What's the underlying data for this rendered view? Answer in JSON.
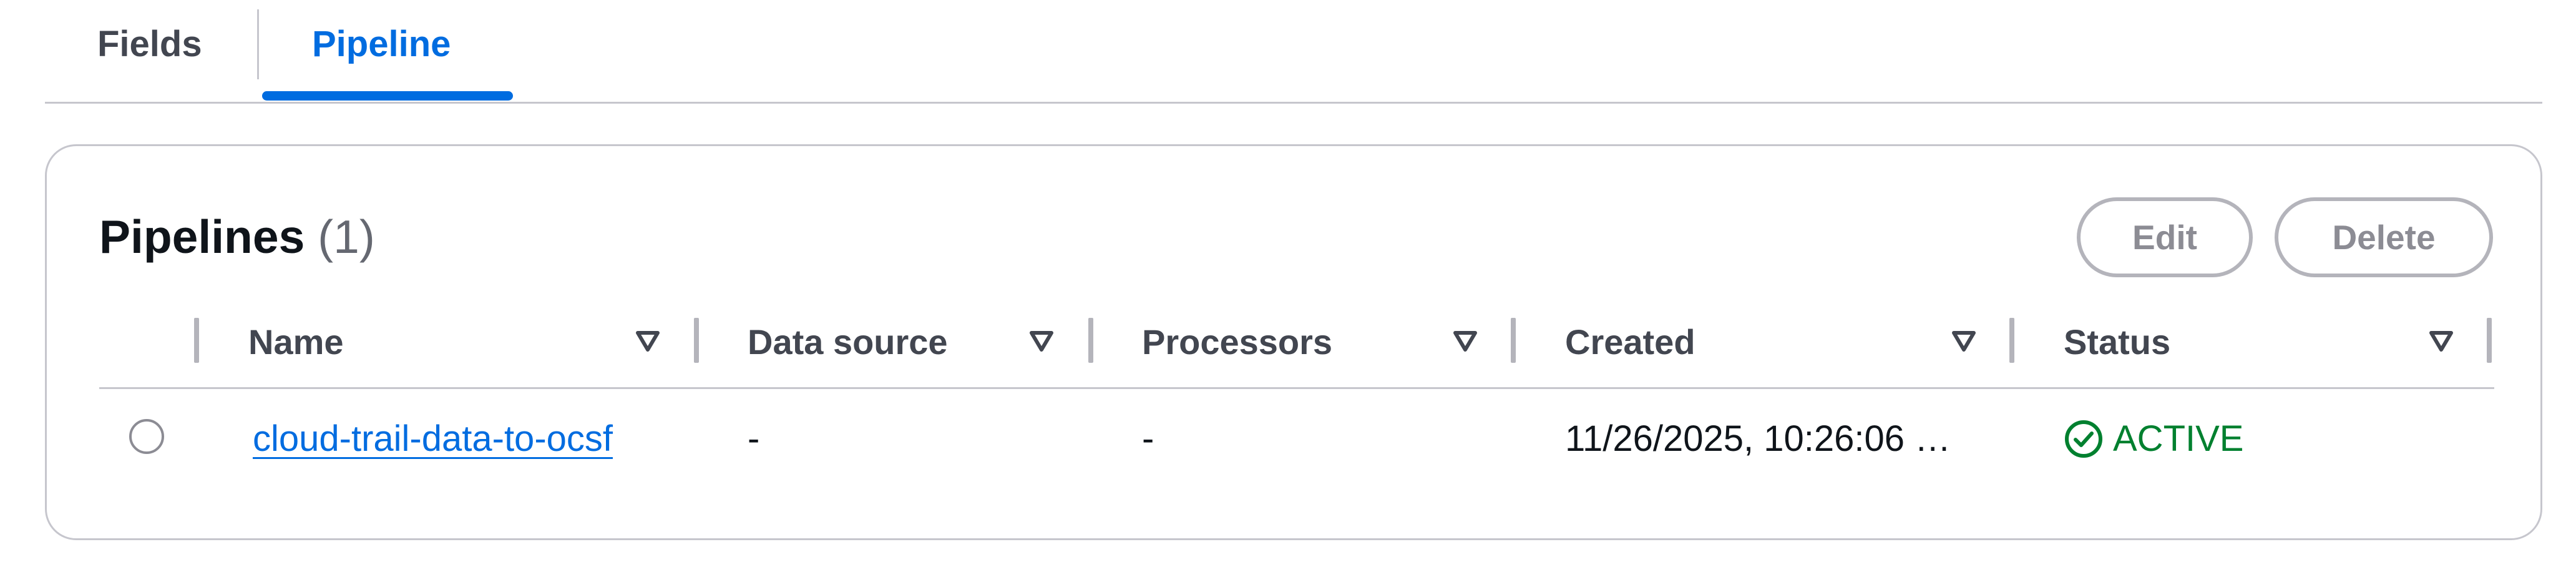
{
  "tabs": [
    {
      "label": "Fields",
      "active": false
    },
    {
      "label": "Pipeline",
      "active": true
    }
  ],
  "pipelines": {
    "title": "Pipelines",
    "count": "(1)",
    "actions": {
      "edit_label": "Edit",
      "delete_label": "Delete"
    },
    "columns": [
      {
        "label": "Name",
        "sort_icon": "sort-descending-icon"
      },
      {
        "label": "Data source",
        "sort_icon": "sort-descending-icon"
      },
      {
        "label": "Processors",
        "sort_icon": "sort-descending-icon"
      },
      {
        "label": "Created",
        "sort_icon": "sort-descending-icon"
      },
      {
        "label": "Status",
        "sort_icon": "sort-descending-icon"
      }
    ],
    "rows": [
      {
        "selected": false,
        "name": "cloud-trail-data-to-ocsf",
        "data_source": "-",
        "processors": "-",
        "created": "11/26/2025, 10:26:06 …",
        "status": "ACTIVE",
        "status_icon": "check-circle-icon"
      }
    ]
  },
  "colors": {
    "accent": "#006ce0",
    "success": "#00802f",
    "border": "#c6c6cd",
    "disabled": "#8c8c94"
  }
}
